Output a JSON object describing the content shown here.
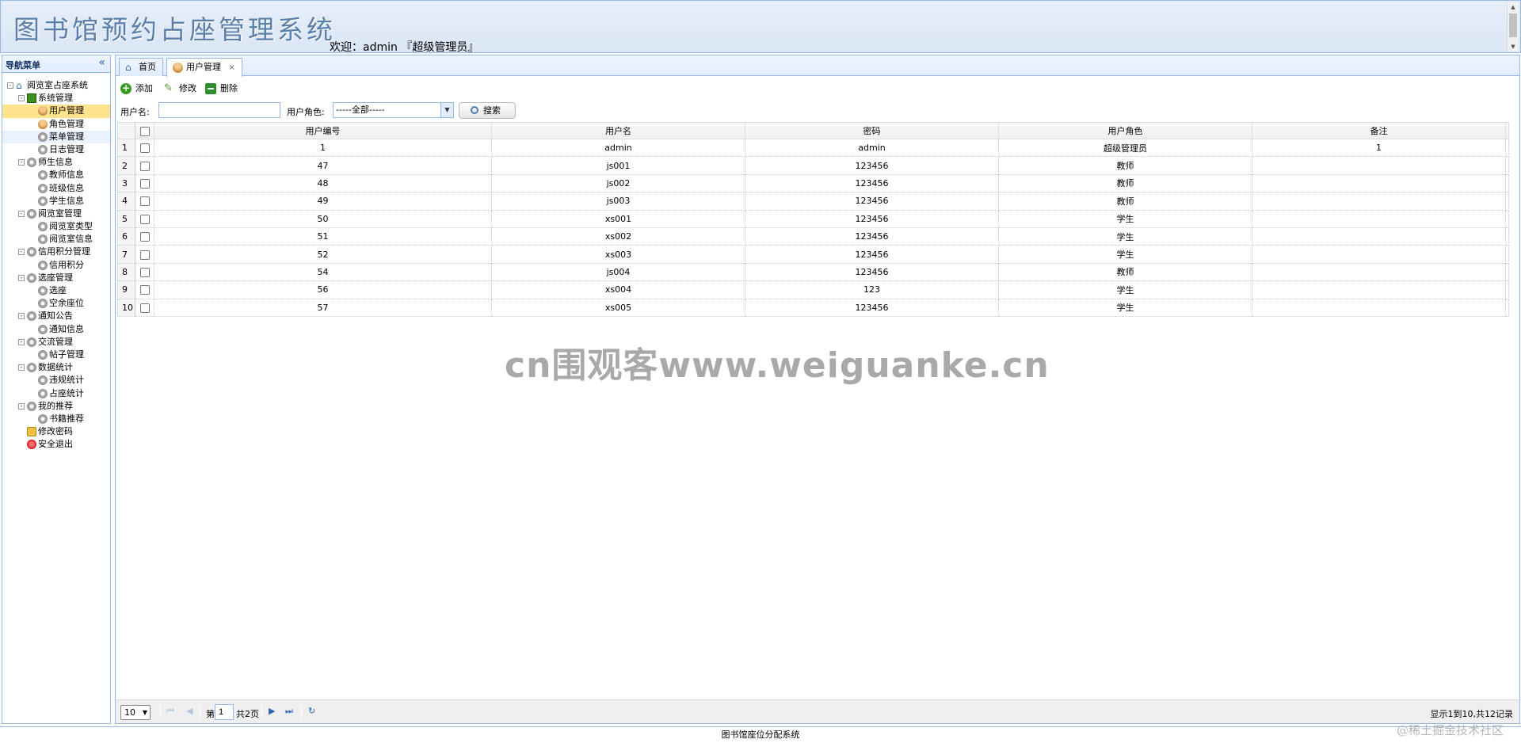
{
  "header": {
    "title": "图书馆预约占座管理系统",
    "welcome": "欢迎：admin 『超级管理员』"
  },
  "nav": {
    "title": "导航菜单",
    "collapse_symbol": "«",
    "tree": [
      {
        "label": "阅览室占座系统",
        "level": 0,
        "icon": "home-icon",
        "toggle": "⊟"
      },
      {
        "label": "系统管理",
        "level": 1,
        "icon": "system-icon",
        "toggle": "⊟"
      },
      {
        "label": "用户管理",
        "level": 2,
        "icon": "user-icon",
        "selected": true
      },
      {
        "label": "角色管理",
        "level": 2,
        "icon": "role-icon"
      },
      {
        "label": "菜单管理",
        "level": 2,
        "icon": "gear-icon",
        "hover": true
      },
      {
        "label": "日志管理",
        "level": 2,
        "icon": "gear-icon"
      },
      {
        "label": "师生信息",
        "level": 1,
        "icon": "gear-icon",
        "toggle": "⊟"
      },
      {
        "label": "教师信息",
        "level": 2,
        "icon": "gear-icon"
      },
      {
        "label": "班级信息",
        "level": 2,
        "icon": "gear-icon"
      },
      {
        "label": "学生信息",
        "level": 2,
        "icon": "gear-icon"
      },
      {
        "label": "阅览室管理",
        "level": 1,
        "icon": "gear-icon",
        "toggle": "⊟"
      },
      {
        "label": "阅览室类型",
        "level": 2,
        "icon": "gear-icon"
      },
      {
        "label": "阅览室信息",
        "level": 2,
        "icon": "gear-icon"
      },
      {
        "label": "信用积分管理",
        "level": 1,
        "icon": "gear-icon",
        "toggle": "⊟"
      },
      {
        "label": "信用积分",
        "level": 2,
        "icon": "gear-icon"
      },
      {
        "label": "选座管理",
        "level": 1,
        "icon": "gear-icon",
        "toggle": "⊟"
      },
      {
        "label": "选座",
        "level": 2,
        "icon": "gear-icon"
      },
      {
        "label": "空余座位",
        "level": 2,
        "icon": "gear-icon"
      },
      {
        "label": "通知公告",
        "level": 1,
        "icon": "gear-icon",
        "toggle": "⊟"
      },
      {
        "label": "通知信息",
        "level": 2,
        "icon": "gear-icon"
      },
      {
        "label": "交流管理",
        "level": 1,
        "icon": "gear-icon",
        "toggle": "⊟"
      },
      {
        "label": "帖子管理",
        "level": 2,
        "icon": "gear-icon"
      },
      {
        "label": "数据统计",
        "level": 1,
        "icon": "gear-icon",
        "toggle": "⊟"
      },
      {
        "label": "违规统计",
        "level": 2,
        "icon": "gear-icon"
      },
      {
        "label": "占座统计",
        "level": 2,
        "icon": "gear-icon"
      },
      {
        "label": "我的推荐",
        "level": 1,
        "icon": "gear-icon",
        "toggle": "⊟"
      },
      {
        "label": "书籍推荐",
        "level": 2,
        "icon": "gear-icon"
      },
      {
        "label": "修改密码",
        "level": 1,
        "icon": "lock-icon"
      },
      {
        "label": "安全退出",
        "level": 1,
        "icon": "exit-icon"
      }
    ]
  },
  "tabs": [
    {
      "label": "首页",
      "icon": "home-icon",
      "active": false
    },
    {
      "label": "用户管理",
      "icon": "user-icon",
      "active": true,
      "close": "×"
    }
  ],
  "toolbar": {
    "add": "添加",
    "edit": "修改",
    "delete": "删除"
  },
  "search": {
    "username_label": "用户名:",
    "username_value": "",
    "role_label": "用户角色:",
    "role_value": "-----全部-----",
    "button": "搜索"
  },
  "table": {
    "headers": [
      "用户编号",
      "用户名",
      "密码",
      "用户角色",
      "备注"
    ],
    "rows": [
      {
        "num": "1",
        "id": "1",
        "username": "admin",
        "password": "admin",
        "role": "超级管理员",
        "remark": "1"
      },
      {
        "num": "2",
        "id": "47",
        "username": "js001",
        "password": "123456",
        "role": "教师",
        "remark": ""
      },
      {
        "num": "3",
        "id": "48",
        "username": "js002",
        "password": "123456",
        "role": "教师",
        "remark": ""
      },
      {
        "num": "4",
        "id": "49",
        "username": "js003",
        "password": "123456",
        "role": "教师",
        "remark": ""
      },
      {
        "num": "5",
        "id": "50",
        "username": "xs001",
        "password": "123456",
        "role": "学生",
        "remark": ""
      },
      {
        "num": "6",
        "id": "51",
        "username": "xs002",
        "password": "123456",
        "role": "学生",
        "remark": ""
      },
      {
        "num": "7",
        "id": "52",
        "username": "xs003",
        "password": "123456",
        "role": "学生",
        "remark": ""
      },
      {
        "num": "8",
        "id": "54",
        "username": "js004",
        "password": "123456",
        "role": "教师",
        "remark": ""
      },
      {
        "num": "9",
        "id": "56",
        "username": "xs004",
        "password": "123",
        "role": "学生",
        "remark": ""
      },
      {
        "num": "10",
        "id": "57",
        "username": "xs005",
        "password": "123456",
        "role": "学生",
        "remark": ""
      }
    ]
  },
  "watermark": "cn围观客www.weiguanke.cn",
  "pager": {
    "page_size": "10",
    "page_prefix": "第",
    "page_number": "1",
    "page_total": "共2页",
    "info": "显示1到10,共12记录"
  },
  "footer": {
    "text": "图书馆座位分配系统",
    "corner_mark": "@稀土掘金技术社区"
  },
  "colors": {
    "border": "#95b8e7",
    "selected": "#ffe48d"
  }
}
